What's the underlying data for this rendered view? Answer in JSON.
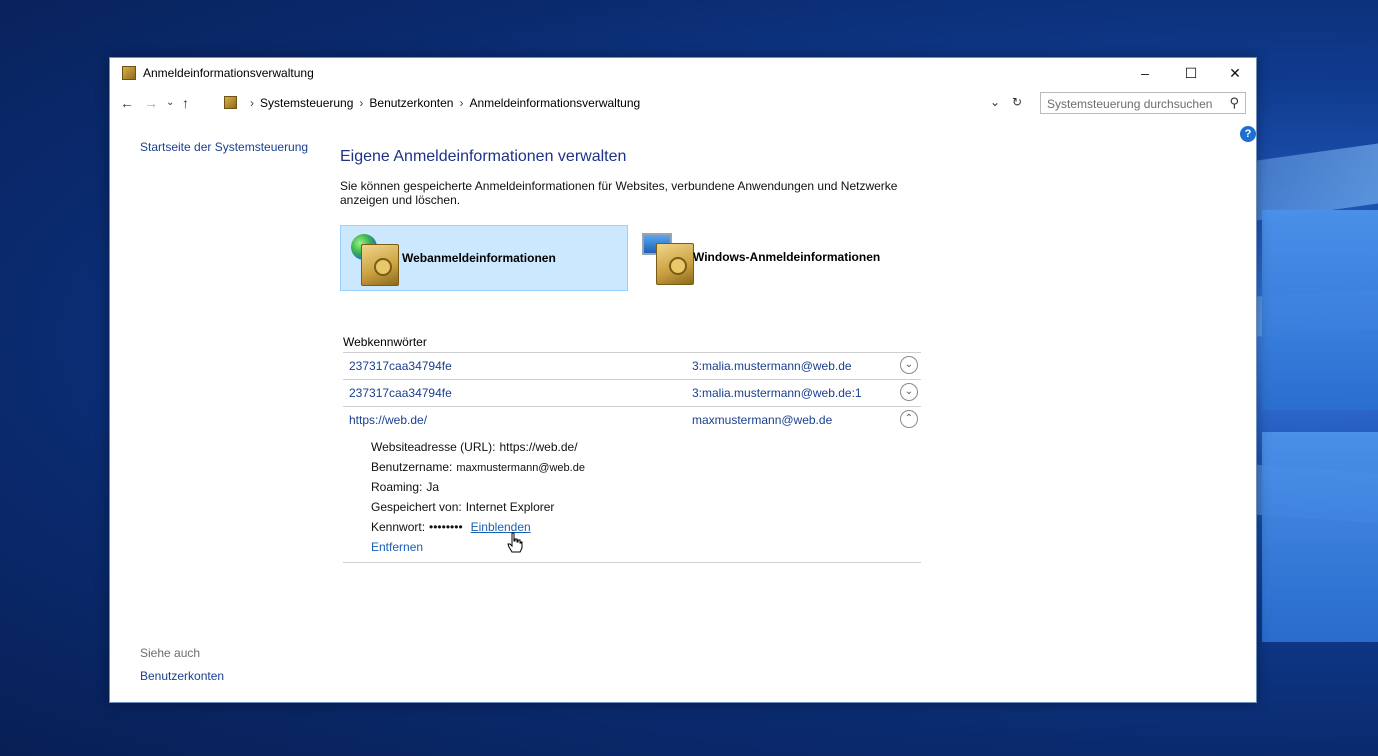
{
  "window": {
    "title": "Anmeldeinformationsverwaltung",
    "controls": {
      "minimize": "–",
      "maximize": "☐",
      "close": "✕"
    }
  },
  "address": {
    "breadcrumbs": [
      "Systemsteuerung",
      "Benutzerkonten",
      "Anmeldeinformationsverwaltung"
    ],
    "search_placeholder": "Systemsteuerung durchsuchen"
  },
  "sidebar": {
    "home_link": "Startseite der Systemsteuerung",
    "see_also_label": "Siehe auch",
    "see_also_link": "Benutzerkonten"
  },
  "main": {
    "heading": "Eigene Anmeldeinformationen verwalten",
    "description": "Sie können gespeicherte Anmeldeinformationen für Websites, verbundene Anwendungen und Netzwerke anzeigen und löschen.",
    "tiles": [
      {
        "label": "Webanmeldeinformationen",
        "active": true
      },
      {
        "label": "Windows-Anmeldeinformationen",
        "active": false
      }
    ],
    "section_title": "Webkennwörter",
    "credentials": [
      {
        "name": "237317caa34794fe",
        "user": "3:malia.mustermann@web.de",
        "expanded": false
      },
      {
        "name": "237317caa34794fe",
        "user": "3:malia.mustermann@web.de:1",
        "expanded": false
      },
      {
        "name": "https://web.de/",
        "user": "maxmustermann@web.de",
        "expanded": true
      }
    ],
    "details": {
      "url_label": "Websiteadresse (URL):",
      "url_value": "https://web.de/",
      "username_label": "Benutzername:",
      "username_value": "maxmustermann@web.de",
      "roaming_label": "Roaming:",
      "roaming_value": "Ja",
      "saved_by_label": "Gespeichert von:",
      "saved_by_value": "Internet Explorer",
      "password_label": "Kennwort:",
      "password_value": "••••••••",
      "show_link": "Einblenden",
      "remove_link": "Entfernen"
    }
  }
}
